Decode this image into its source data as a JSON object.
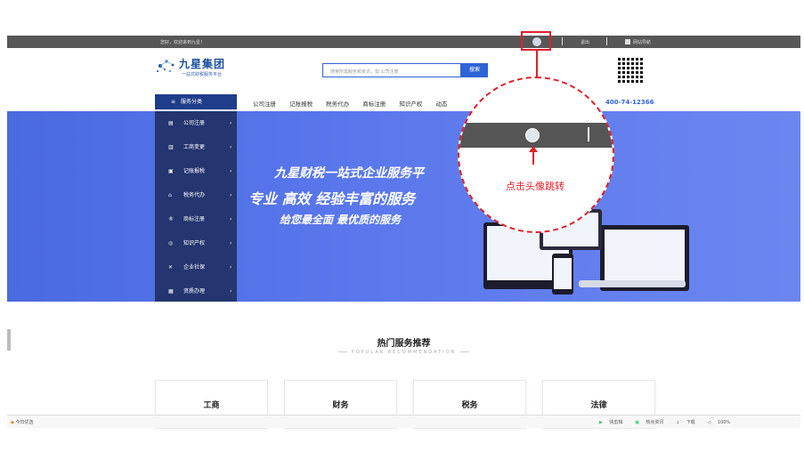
{
  "topbar": {
    "greeting": "您好，欢迎来到九星！",
    "logout": "退出",
    "site_nav": "网站导航"
  },
  "logo": {
    "name": "九星集团",
    "subtitle": "一站式财税服务平台"
  },
  "search": {
    "placeholder": "搜索所需服务和资讯，如 公司注册",
    "button": "搜索"
  },
  "nav": {
    "category_label": "服务分类",
    "items": [
      "公司注册",
      "记账报税",
      "税务代办",
      "商标注册",
      "知识产权",
      "动态"
    ],
    "phone": "400-74-12366"
  },
  "side_menu": [
    {
      "label": "公司注册",
      "icon": "document-icon"
    },
    {
      "label": "工商变更",
      "icon": "file-icon"
    },
    {
      "label": "记账报税",
      "icon": "ledger-icon"
    },
    {
      "label": "税务代办",
      "icon": "bank-icon"
    },
    {
      "label": "商标注册",
      "icon": "trademark-icon"
    },
    {
      "label": "知识产权",
      "icon": "database-icon"
    },
    {
      "label": "企业社保",
      "icon": "tools-icon"
    },
    {
      "label": "资质办理",
      "icon": "certificate-icon"
    }
  ],
  "banner": {
    "line1": "九星财税一站式企业服务平",
    "line2": "专业  高效  经验丰富的服务",
    "line3": "给您最全面  最优质的服务"
  },
  "hot": {
    "title": "热门服务推荐",
    "subtitle": "POPULAR RECOMMENDATION",
    "cards": [
      "工商",
      "财务",
      "税务",
      "法律"
    ]
  },
  "statusbar": {
    "left": "今日优选",
    "items": [
      "快剪辑",
      "热点资讯",
      "下载",
      "100%"
    ]
  },
  "annotation": {
    "text": "点击头像跳转",
    "color": "#e0202a"
  }
}
